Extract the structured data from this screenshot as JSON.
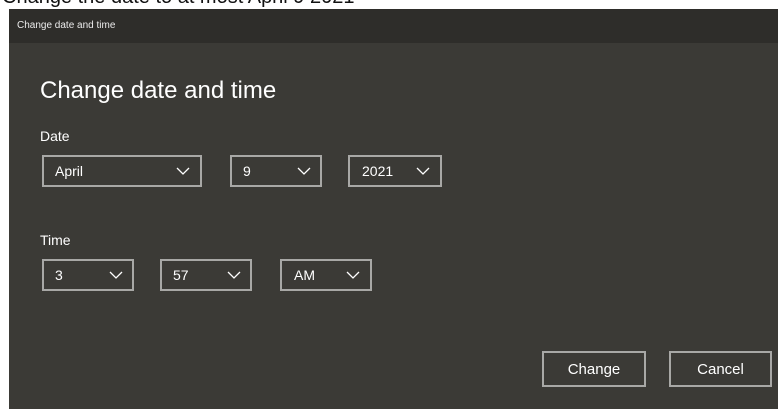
{
  "page": {
    "background_caption": "Change the date to at most April 9 2021"
  },
  "window": {
    "title": "Change date and time"
  },
  "heading": "Change date and time",
  "date": {
    "label": "Date",
    "month": "April",
    "day": "9",
    "year": "2021"
  },
  "time": {
    "label": "Time",
    "hour": "3",
    "minute": "57",
    "period": "AM"
  },
  "buttons": {
    "change": "Change",
    "cancel": "Cancel"
  },
  "icons": {
    "dropdown": "chevron-down-icon"
  },
  "colors": {
    "dialog_background": "#3b3a36",
    "titlebar_background": "#2e2d2a",
    "control_border": "#a8a8a6",
    "text": "#ffffff"
  }
}
